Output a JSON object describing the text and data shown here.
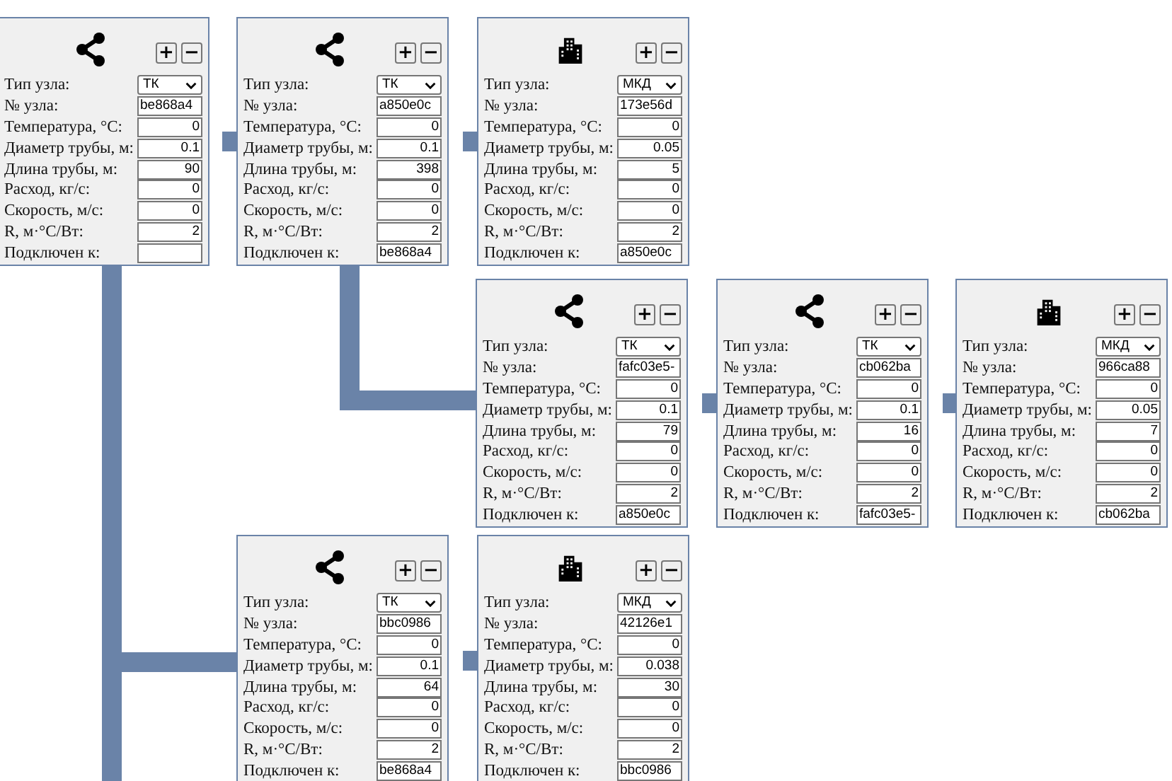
{
  "nodes": [
    {
      "kind": "tk",
      "buttons": [
        "+",
        "−"
      ],
      "fields": [
        {
          "label": "Тип узла:",
          "kind": "select",
          "value": "ТК"
        },
        {
          "label": "№ узла:",
          "kind": "text",
          "value": "be868a4"
        },
        {
          "label": "Температура, °C:",
          "kind": "number",
          "value": "0"
        },
        {
          "label": "Диаметр трубы, м:",
          "kind": "number",
          "value": "0.1"
        },
        {
          "label": "Длина трубы, м:",
          "kind": "number",
          "value": "90"
        },
        {
          "label": "Расход, кг/с:",
          "kind": "number",
          "value": "0"
        },
        {
          "label": "Скорость, м/с:",
          "kind": "number",
          "value": "0"
        },
        {
          "label": "R, м·°C/Вт:",
          "kind": "number",
          "value": "2"
        },
        {
          "label": "Подключен к:",
          "kind": "text"
        }
      ]
    },
    {
      "kind": "tk",
      "buttons": [
        "+",
        "−"
      ],
      "fields": [
        {
          "label": "Тип узла:",
          "kind": "select",
          "value": "ТК"
        },
        {
          "label": "№ узла:",
          "kind": "text",
          "value": "a850e0c"
        },
        {
          "label": "Температура, °C:",
          "kind": "number",
          "value": "0"
        },
        {
          "label": "Диаметр трубы, м:",
          "kind": "number",
          "value": "0.1"
        },
        {
          "label": "Длина трубы, м:",
          "kind": "number",
          "value": "398"
        },
        {
          "label": "Расход, кг/с:",
          "kind": "number",
          "value": "0"
        },
        {
          "label": "Скорость, м/с:",
          "kind": "number",
          "value": "0"
        },
        {
          "label": "R, м·°C/Вт:",
          "kind": "number",
          "value": "2"
        },
        {
          "label": "Подключен к:",
          "kind": "text",
          "value": "be868a4"
        }
      ]
    },
    {
      "kind": "mkd",
      "buttons": [
        "+",
        "−"
      ],
      "fields": [
        {
          "label": "Тип узла:",
          "kind": "select",
          "value": "МКД"
        },
        {
          "label": "№ узла:",
          "kind": "text",
          "value": "173e56d"
        },
        {
          "label": "Температура, °C:",
          "kind": "number",
          "value": "0"
        },
        {
          "label": "Диаметр трубы, м:",
          "kind": "number",
          "value": "0.05"
        },
        {
          "label": "Длина трубы, м:",
          "kind": "number",
          "value": "5"
        },
        {
          "label": "Расход, кг/с:",
          "kind": "number",
          "value": "0"
        },
        {
          "label": "Скорость, м/с:",
          "kind": "number",
          "value": "0"
        },
        {
          "label": "R, м·°C/Вт:",
          "kind": "number",
          "value": "2"
        },
        {
          "label": "Подключен к:",
          "kind": "text",
          "value": "a850e0c"
        }
      ]
    },
    {
      "kind": "tk",
      "buttons": [
        "+",
        "−"
      ],
      "fields": [
        {
          "label": "Тип узла:",
          "kind": "select",
          "value": "ТК"
        },
        {
          "label": "№ узла:",
          "kind": "text",
          "value": "fafc03e5-"
        },
        {
          "label": "Температура, °C:",
          "kind": "number",
          "value": "0"
        },
        {
          "label": "Диаметр трубы, м:",
          "kind": "number",
          "value": "0.1"
        },
        {
          "label": "Длина трубы, м:",
          "kind": "number",
          "value": "79"
        },
        {
          "label": "Расход, кг/с:",
          "kind": "number",
          "value": "0"
        },
        {
          "label": "Скорость, м/с:",
          "kind": "number",
          "value": "0"
        },
        {
          "label": "R, м·°C/Вт:",
          "kind": "number",
          "value": "2"
        },
        {
          "label": "Подключен к:",
          "kind": "text",
          "value": "a850e0c"
        }
      ]
    },
    {
      "kind": "tk",
      "buttons": [
        "+",
        "−"
      ],
      "fields": [
        {
          "label": "Тип узла:",
          "kind": "select",
          "value": "ТК"
        },
        {
          "label": "№ узла:",
          "kind": "text",
          "value": "cb062ba"
        },
        {
          "label": "Температура, °C:",
          "kind": "number",
          "value": "0"
        },
        {
          "label": "Диаметр трубы, м:",
          "kind": "number",
          "value": "0.1"
        },
        {
          "label": "Длина трубы, м:",
          "kind": "number",
          "value": "16"
        },
        {
          "label": "Расход, кг/с:",
          "kind": "number",
          "value": "0"
        },
        {
          "label": "Скорость, м/с:",
          "kind": "number",
          "value": "0"
        },
        {
          "label": "R, м·°C/Вт:",
          "kind": "number",
          "value": "2"
        },
        {
          "label": "Подключен к:",
          "kind": "text",
          "value": "fafc03e5-"
        }
      ]
    },
    {
      "kind": "mkd",
      "buttons": [
        "+",
        "−"
      ],
      "fields": [
        {
          "label": "Тип узла:",
          "kind": "select",
          "value": "МКД"
        },
        {
          "label": "№ узла:",
          "kind": "text",
          "value": "966ca88"
        },
        {
          "label": "Температура, °C:",
          "kind": "number",
          "value": "0"
        },
        {
          "label": "Диаметр трубы, м:",
          "kind": "number",
          "value": "0.05"
        },
        {
          "label": "Длина трубы, м:",
          "kind": "number",
          "value": "7"
        },
        {
          "label": "Расход, кг/с:",
          "kind": "number",
          "value": "0"
        },
        {
          "label": "Скорость, м/с:",
          "kind": "number",
          "value": "0"
        },
        {
          "label": "R, м·°C/Вт:",
          "kind": "number",
          "value": "2"
        },
        {
          "label": "Подключен к:",
          "kind": "text",
          "value": "cb062ba"
        }
      ]
    },
    {
      "kind": "tk",
      "buttons": [
        "+",
        "−"
      ],
      "fields": [
        {
          "label": "Тип узла:",
          "kind": "select",
          "value": "ТК"
        },
        {
          "label": "№ узла:",
          "kind": "text",
          "value": "bbc0986"
        },
        {
          "label": "Температура, °C:",
          "kind": "number",
          "value": "0"
        },
        {
          "label": "Диаметр трубы, м:",
          "kind": "number",
          "value": "0.1"
        },
        {
          "label": "Длина трубы, м:",
          "kind": "number",
          "value": "64"
        },
        {
          "label": "Расход, кг/с:",
          "kind": "number",
          "value": "0"
        },
        {
          "label": "Скорость, м/с:",
          "kind": "number",
          "value": "0"
        },
        {
          "label": "R, м·°C/Вт:",
          "kind": "number",
          "value": "2"
        },
        {
          "label": "Подключен к:",
          "kind": "text",
          "value": "be868a4"
        }
      ]
    },
    {
      "kind": "mkd",
      "buttons": [
        "+",
        "−"
      ],
      "fields": [
        {
          "label": "Тип узла:",
          "kind": "select",
          "value": "МКД"
        },
        {
          "label": "№ узла:",
          "kind": "text",
          "value": "42126e1"
        },
        {
          "label": "Температура, °C:",
          "kind": "number",
          "value": "0"
        },
        {
          "label": "Диаметр трубы, м:",
          "kind": "number",
          "value": "0.038"
        },
        {
          "label": "Длина трубы, м:",
          "kind": "number",
          "value": "30"
        },
        {
          "label": "Расход, кг/с:",
          "kind": "number",
          "value": "0"
        },
        {
          "label": "Скорость, м/с:",
          "kind": "number",
          "value": "0"
        },
        {
          "label": "R, м·°C/Вт:",
          "kind": "number",
          "value": "2"
        },
        {
          "label": "Подключен к:",
          "kind": "text",
          "value": "bbc0986"
        }
      ]
    }
  ]
}
